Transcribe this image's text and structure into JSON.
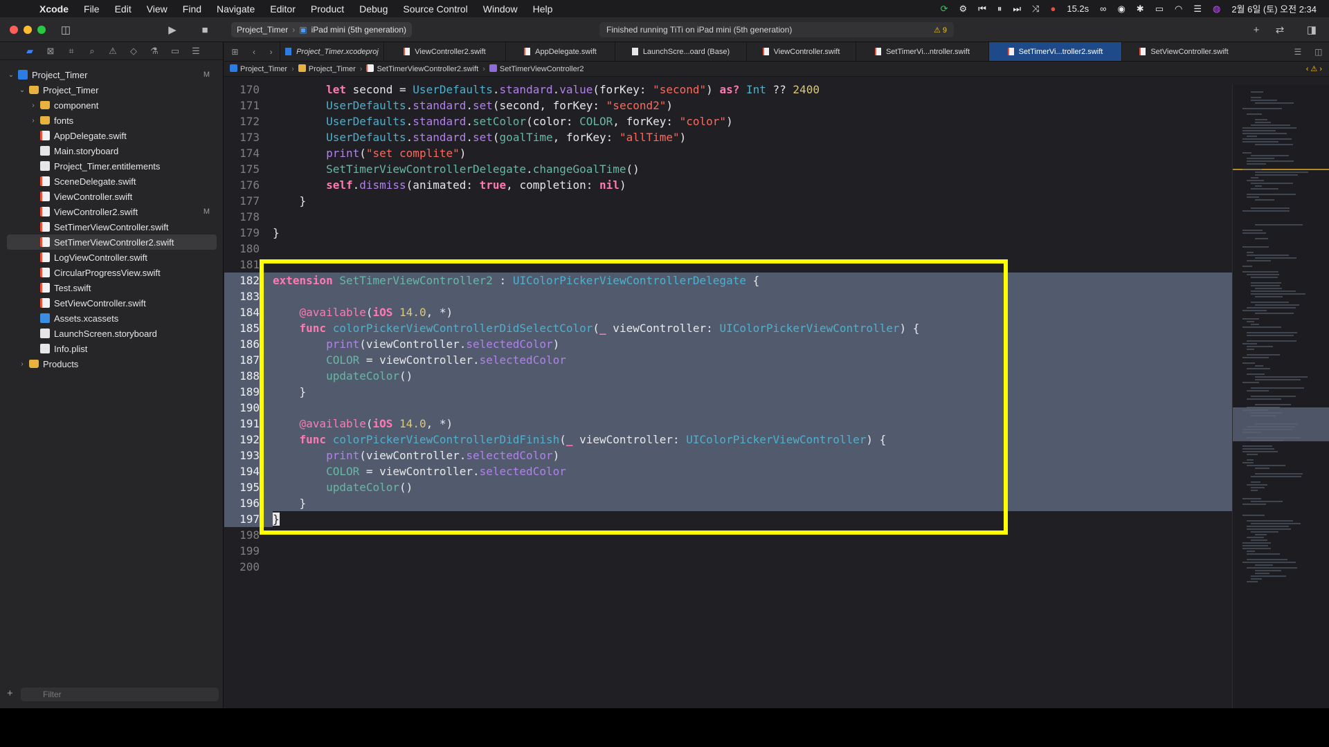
{
  "menubar": {
    "items": [
      "Xcode",
      "File",
      "Edit",
      "View",
      "Find",
      "Navigate",
      "Editor",
      "Product",
      "Debug",
      "Source Control",
      "Window",
      "Help"
    ],
    "cpu": "15.2s",
    "datetime": "2월 6일 (토) 오전 2:34"
  },
  "toolbar": {
    "scheme_project": "Project_Timer",
    "scheme_device": "iPad mini (5th generation)",
    "activity_text": "Finished running TiTi on iPad mini (5th generation)",
    "warning_count": "9"
  },
  "navigator": {
    "items": [
      {
        "label": "Project_Timer",
        "icon": "project-icon",
        "badge": "M"
      },
      {
        "label": "Project_Timer",
        "icon": "folder-icon",
        "badge": ""
      },
      {
        "label": "component",
        "icon": "folder-icon",
        "badge": ""
      },
      {
        "label": "fonts",
        "icon": "folder-icon",
        "badge": ""
      },
      {
        "label": "AppDelegate.swift",
        "icon": "swift-file-icon",
        "badge": ""
      },
      {
        "label": "Main.storyboard",
        "icon": "storyboard-icon",
        "badge": ""
      },
      {
        "label": "Project_Timer.entitlements",
        "icon": "entitlements-icon",
        "badge": ""
      },
      {
        "label": "SceneDelegate.swift",
        "icon": "swift-file-icon",
        "badge": ""
      },
      {
        "label": "ViewController.swift",
        "icon": "swift-file-icon",
        "badge": ""
      },
      {
        "label": "ViewController2.swift",
        "icon": "swift-file-icon",
        "badge": "M"
      },
      {
        "label": "SetTimerViewController.swift",
        "icon": "swift-file-icon",
        "badge": ""
      },
      {
        "label": "SetTimerViewController2.swift",
        "icon": "swift-file-icon",
        "badge": ""
      },
      {
        "label": "LogViewController.swift",
        "icon": "swift-file-icon",
        "badge": ""
      },
      {
        "label": "CircularProgressView.swift",
        "icon": "swift-file-icon",
        "badge": ""
      },
      {
        "label": "Test.swift",
        "icon": "swift-file-icon",
        "badge": ""
      },
      {
        "label": "SetViewController.swift",
        "icon": "swift-file-icon",
        "badge": ""
      },
      {
        "label": "Assets.xcassets",
        "icon": "assets-icon",
        "badge": ""
      },
      {
        "label": "LaunchScreen.storyboard",
        "icon": "storyboard-icon",
        "badge": ""
      },
      {
        "label": "Info.plist",
        "icon": "plist-icon",
        "badge": ""
      },
      {
        "label": "Products",
        "icon": "folder-icon",
        "badge": ""
      }
    ],
    "filter_placeholder": "Filter"
  },
  "tabs": [
    "Project_Timer.xcodeproj",
    "ViewController2.swift",
    "AppDelegate.swift",
    "LaunchScre...oard (Base)",
    "ViewController.swift",
    "SetTimerVi...ntroller.swift",
    "SetTimerVi...troller2.swift",
    "SetViewController.swift"
  ],
  "jumpbar": [
    "Project_Timer",
    "Project_Timer",
    "SetTimerViewController2.swift",
    "SetTimerViewController2"
  ],
  "code": {
    "line_numbers": [
      "170",
      "171",
      "172",
      "173",
      "174",
      "175",
      "176",
      "177",
      "178",
      "179",
      "180",
      "181",
      "182",
      "183",
      "184",
      "185",
      "186",
      "187",
      "188",
      "189",
      "190",
      "191",
      "192",
      "193",
      "194",
      "195",
      "196",
      "197",
      "198",
      "199",
      "200"
    ],
    "selected_range": [
      "182",
      "197"
    ]
  },
  "colors": {
    "annotation_border": "#ffff00",
    "selection": "#525b6e",
    "active_tab": "#1f4a8a",
    "keyword": "#ff7ab2",
    "string": "#fc6a5d"
  }
}
